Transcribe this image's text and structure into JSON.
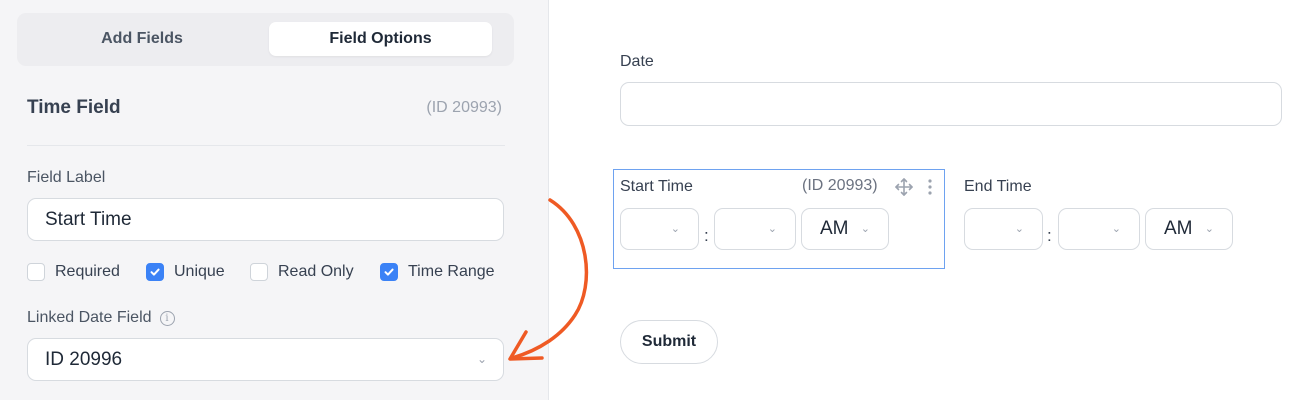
{
  "tabs": [
    {
      "label": "Add Fields",
      "active": false
    },
    {
      "label": "Field Options",
      "active": true
    }
  ],
  "field": {
    "type_title": "Time Field",
    "id_text": "(ID 20993)",
    "label_title": "Field Label",
    "label_value": "Start Time"
  },
  "options": [
    {
      "label": "Required",
      "checked": false
    },
    {
      "label": "Unique",
      "checked": true
    },
    {
      "label": "Read Only",
      "checked": false
    },
    {
      "label": "Time Range",
      "checked": true
    }
  ],
  "linked_date": {
    "title": "Linked Date Field",
    "value": "ID 20996"
  },
  "preview": {
    "date_label": "Date",
    "start_label": "Start Time",
    "start_id": "(ID 20993)",
    "end_label": "End Time",
    "colon": ":",
    "ampm": "AM",
    "submit_label": "Submit"
  },
  "colors": {
    "accent": "#3b82f6",
    "selection_border": "#6ea2f0",
    "annotation_arrow": "#ef5a24"
  }
}
